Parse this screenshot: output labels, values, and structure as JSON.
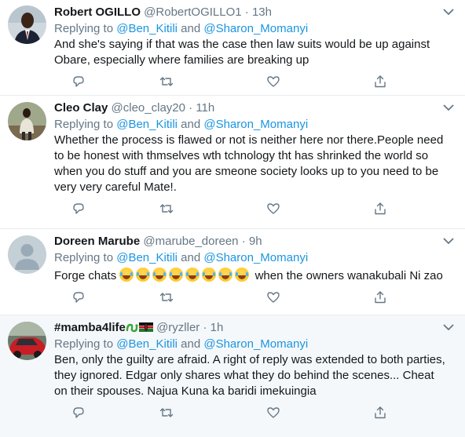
{
  "tweets": [
    {
      "name": "Robert OGILLO",
      "handle": "@RobertOGILLO1",
      "time": "13h",
      "replying_to_prefix": "Replying to",
      "mention1": "@Ben_Kitili",
      "and": "and",
      "mention2": "@Sharon_Momanyi",
      "text": "And she's saying if that was the case then law suits would be up against Obare, especially where families are breaking up",
      "avatar": "man-in-suit-photo"
    },
    {
      "name": "Cleo Clay",
      "handle": "@cleo_clay20",
      "time": "11h",
      "replying_to_prefix": "Replying to",
      "mention1": "@Ben_Kitili",
      "and": "and",
      "mention2": "@Sharon_Momanyi",
      "text": "Whether the process is flawed or not is neither here nor there.People need to be honest with thmselves wth tchnology tht has shrinked the world so when you do stuff and you are smeone society looks up to you need to be very very careful Mate!.",
      "avatar": "man-standing-photo"
    },
    {
      "name": "Doreen Marube",
      "handle": "@marube_doreen",
      "time": "9h",
      "replying_to_prefix": "Replying to",
      "mention1": "@Ben_Kitili",
      "and": "and",
      "mention2": "@Sharon_Momanyi",
      "text_prefix": "Forge chats",
      "emoji_count": 8,
      "emoji": "face-with-tears-of-joy",
      "text_suffix": "when the owners wanakubali Ni zao",
      "avatar": "default-avatar"
    },
    {
      "name": "#mamba4life",
      "handle": "@ryzller",
      "time": "1h",
      "replying_to_prefix": "Replying to",
      "mention1": "@Ben_Kitili",
      "and": "and",
      "mention2": "@Sharon_Momanyi",
      "text": "Ben, only the guilty are afraid. A right of reply was extended to both parties, they ignored. Edgar only shares what they do behind the scenes... Cheat on their spouses. Najua Kuna ka baridi imekuingia",
      "avatar": "red-car-photo",
      "name_icons": [
        "snake-icon",
        "kenya-flag-icon"
      ]
    }
  ],
  "colors": {
    "link": "#1b95e0",
    "muted": "#657786",
    "text": "#14171a",
    "border": "#e6ecf0",
    "highlight": "#f5f8fa"
  }
}
